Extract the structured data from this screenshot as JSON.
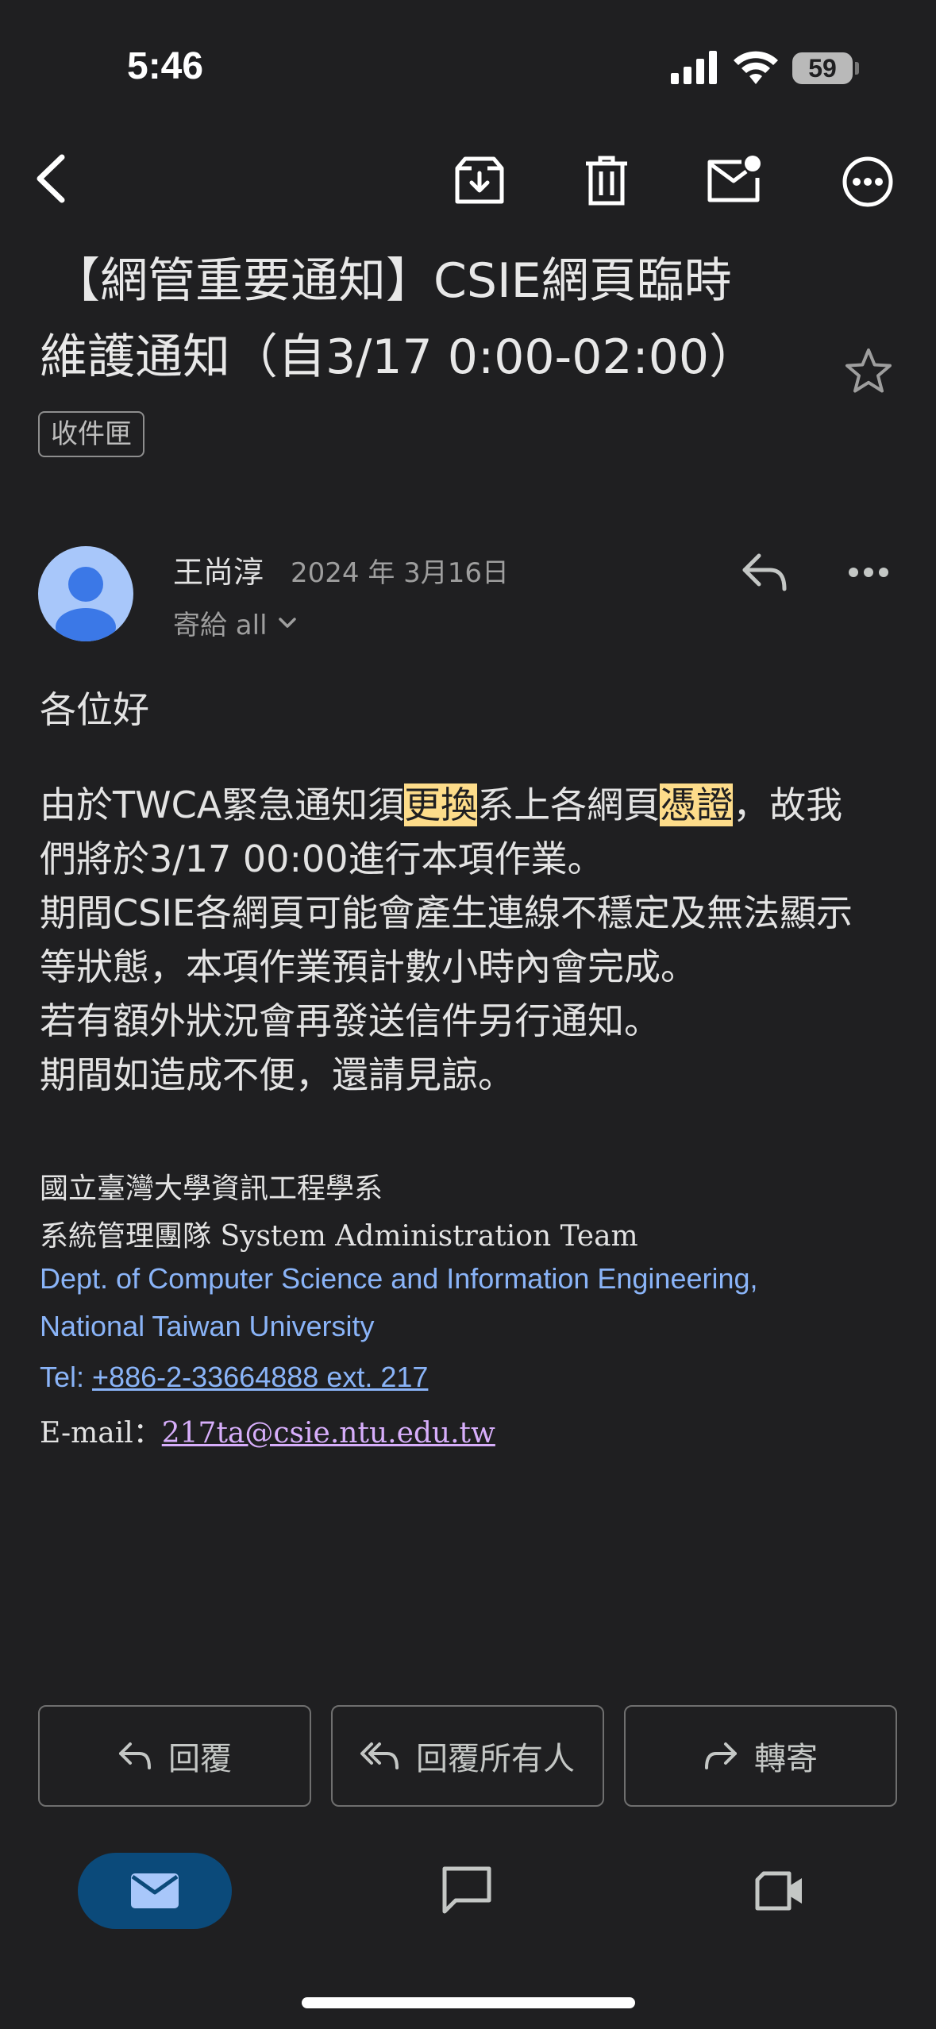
{
  "status_bar": {
    "time": "5:46",
    "battery": "59"
  },
  "email": {
    "subject_line1": "【網管重要通知】CSIE網頁臨時",
    "subject_line2": "維護通知（自3/17 0:00-02:00）",
    "label": "收件匣",
    "sender": {
      "name": "王尚淳",
      "date": "2024 年 3月16日",
      "recipient": "寄給 all"
    },
    "greeting": "各位好",
    "body": {
      "l1_a": "由於TWCA緊急通知須",
      "l1_hl1": "更換",
      "l1_b": "系上各網頁",
      "l1_hl2": "憑證",
      "l1_c": "，故我",
      "l2": "們將於3/17 00:00進行本項作業。",
      "l3": "期間CSIE各網頁可能會產生連線不穩定及無法顯示",
      "l4": "等狀態，本項作業預計數小時內會完成。",
      "l5": "若有額外狀況會再發送信件另行通知。",
      "l6": "期間如造成不便，還請見諒。"
    },
    "signature": {
      "org": "國立臺灣大學資訊工程學系",
      "team_cn": "系統管理團隊",
      "team_en": " System Administration Team",
      "dept_line1": "Dept. of Computer Science and Information Engineering,",
      "dept_line2": "National Taiwan University",
      "tel_label": "Tel: ",
      "tel_value": "+886-2-33664888 ext. 217",
      "email_label": "E-mail：",
      "email_value": "217ta@csie.ntu.edu.tw"
    }
  },
  "actions": {
    "reply": "回覆",
    "reply_all": "回覆所有人",
    "forward": "轉寄"
  },
  "icons": {
    "back": "back-arrow-icon",
    "archive": "archive-icon",
    "delete": "trash-icon",
    "mark_unread": "mark-unread-icon",
    "more": "more-icon",
    "star": "star-icon",
    "reply": "reply-icon",
    "reply_all": "reply-all-icon",
    "forward": "forward-icon",
    "mail": "mail-icon",
    "chat": "chat-icon",
    "meet": "video-icon"
  },
  "colors": {
    "background": "#1f1f21",
    "highlight": "#fddc8a",
    "link": "#8ab4f8",
    "visited_link": "#d7aefb",
    "nav_active": "#0b4a7a"
  }
}
